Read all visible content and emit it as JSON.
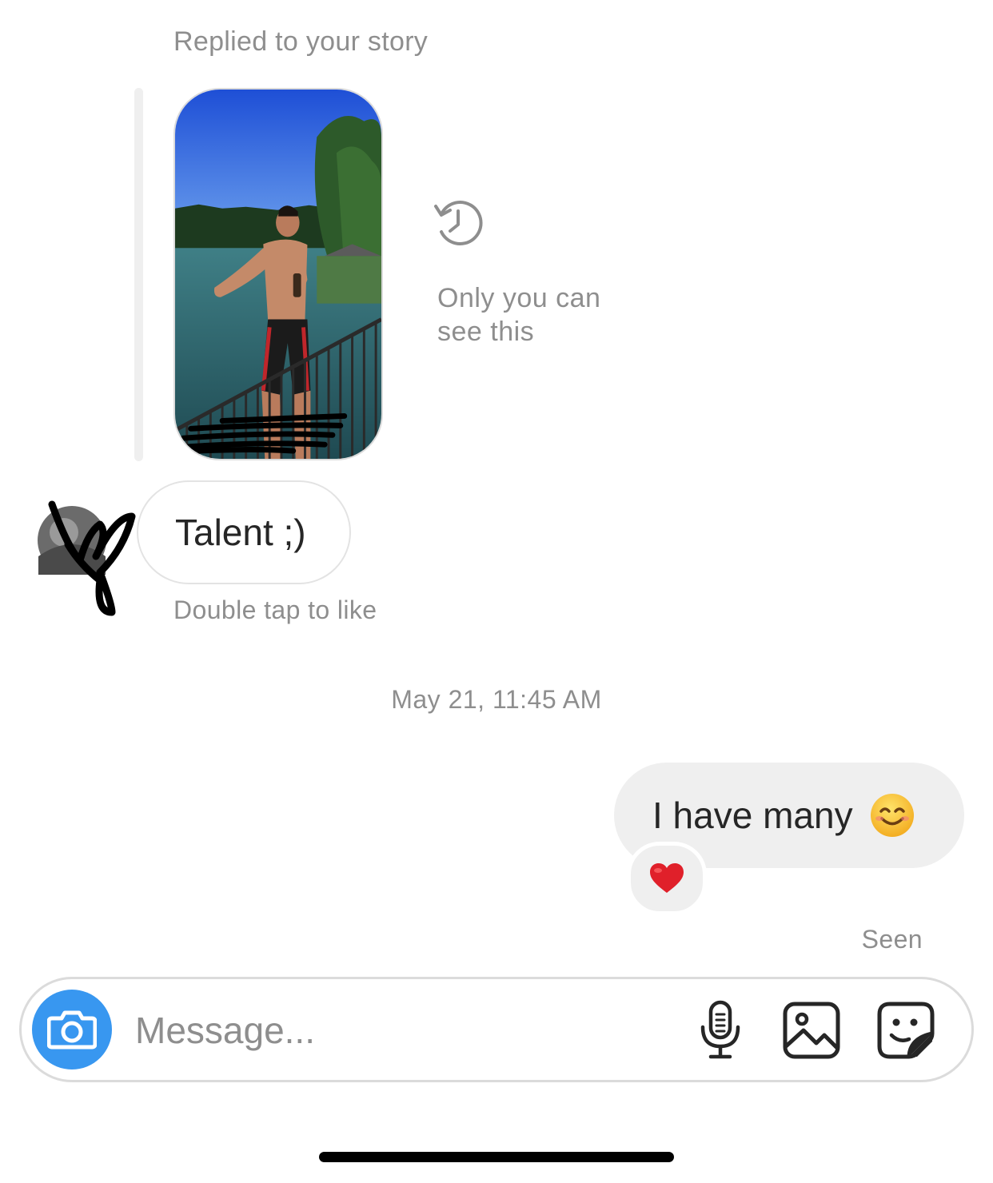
{
  "story": {
    "caption": "Replied to your story",
    "private_note": "Only you can\nsee this",
    "history_icon": "history-clock-icon"
  },
  "incoming": {
    "message": "Talent ;)",
    "hint": "Double tap to like"
  },
  "divider": {
    "timestamp": "May 21, 11:45 AM"
  },
  "outgoing": {
    "message": "I have many",
    "emoji": "smiling-face-emoji",
    "reaction": "red-heart-emoji",
    "status": "Seen"
  },
  "composer": {
    "placeholder": "Message...",
    "camera_color": "#3897f0",
    "icons": [
      "camera-icon",
      "microphone-icon",
      "gallery-icon",
      "sticker-icon"
    ]
  },
  "colors": {
    "secondary_text": "#8e8e8e",
    "bubble_out": "#efefef",
    "primary_text": "#262626"
  }
}
